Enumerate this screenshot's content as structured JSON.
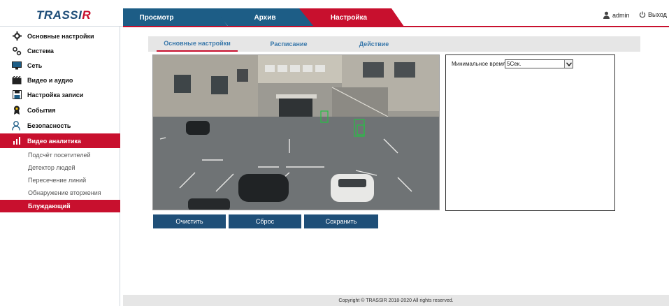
{
  "app": {
    "logo_main": "TRASSI",
    "logo_accent": "R"
  },
  "header": {
    "tabs": [
      {
        "label": "Просмотр"
      },
      {
        "label": "Архив"
      },
      {
        "label": "Настройка"
      }
    ],
    "user_label": "admin",
    "logout_label": "Выход"
  },
  "sidebar": {
    "items": [
      {
        "label": "Основные настройки",
        "icon": "gear-icon"
      },
      {
        "label": "Система",
        "icon": "gears-icon"
      },
      {
        "label": "Сеть",
        "icon": "network-icon"
      },
      {
        "label": "Видео и аудио",
        "icon": "video-audio-icon"
      },
      {
        "label": "Настройка записи",
        "icon": "save-icon"
      },
      {
        "label": "События",
        "icon": "events-icon"
      },
      {
        "label": "Безопасность",
        "icon": "user-shield-icon"
      },
      {
        "label": "Видео аналитика",
        "icon": "chart-icon"
      }
    ],
    "subitems": [
      {
        "label": "Подсчёт посетителей"
      },
      {
        "label": "Детектор людей"
      },
      {
        "label": "Пересечение линий"
      },
      {
        "label": "Обнаружение вторжения"
      },
      {
        "label": "Блуждающий"
      }
    ]
  },
  "main": {
    "subtabs": [
      {
        "label": "Основные настройки"
      },
      {
        "label": "Расписание"
      },
      {
        "label": "Действие"
      }
    ],
    "settings": {
      "min_time_label": "Минимальное время",
      "min_time_value": "5Сек."
    },
    "buttons": {
      "clear": "Очистить",
      "reset": "Сброс",
      "save": "Сохранить"
    }
  },
  "footer": {
    "copyright": "Copyright © TRASSIR 2018-2020 All rights reserved."
  },
  "colors": {
    "accent_red": "#c8102e",
    "brand_blue": "#1d5d86",
    "button_blue": "#1f4f78"
  }
}
